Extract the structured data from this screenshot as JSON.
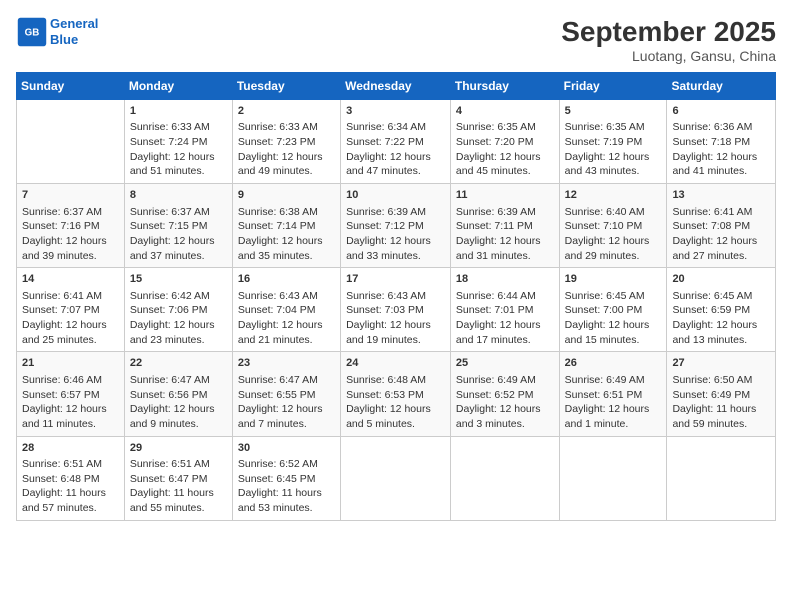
{
  "logo": {
    "line1": "General",
    "line2": "Blue"
  },
  "title": "September 2025",
  "subtitle": "Luotang, Gansu, China",
  "days_header": [
    "Sunday",
    "Monday",
    "Tuesday",
    "Wednesday",
    "Thursday",
    "Friday",
    "Saturday"
  ],
  "weeks": [
    [
      {
        "day": "",
        "sunrise": "",
        "sunset": "",
        "daylight": ""
      },
      {
        "day": "1",
        "sunrise": "Sunrise: 6:33 AM",
        "sunset": "Sunset: 7:24 PM",
        "daylight": "Daylight: 12 hours and 51 minutes."
      },
      {
        "day": "2",
        "sunrise": "Sunrise: 6:33 AM",
        "sunset": "Sunset: 7:23 PM",
        "daylight": "Daylight: 12 hours and 49 minutes."
      },
      {
        "day": "3",
        "sunrise": "Sunrise: 6:34 AM",
        "sunset": "Sunset: 7:22 PM",
        "daylight": "Daylight: 12 hours and 47 minutes."
      },
      {
        "day": "4",
        "sunrise": "Sunrise: 6:35 AM",
        "sunset": "Sunset: 7:20 PM",
        "daylight": "Daylight: 12 hours and 45 minutes."
      },
      {
        "day": "5",
        "sunrise": "Sunrise: 6:35 AM",
        "sunset": "Sunset: 7:19 PM",
        "daylight": "Daylight: 12 hours and 43 minutes."
      },
      {
        "day": "6",
        "sunrise": "Sunrise: 6:36 AM",
        "sunset": "Sunset: 7:18 PM",
        "daylight": "Daylight: 12 hours and 41 minutes."
      }
    ],
    [
      {
        "day": "7",
        "sunrise": "Sunrise: 6:37 AM",
        "sunset": "Sunset: 7:16 PM",
        "daylight": "Daylight: 12 hours and 39 minutes."
      },
      {
        "day": "8",
        "sunrise": "Sunrise: 6:37 AM",
        "sunset": "Sunset: 7:15 PM",
        "daylight": "Daylight: 12 hours and 37 minutes."
      },
      {
        "day": "9",
        "sunrise": "Sunrise: 6:38 AM",
        "sunset": "Sunset: 7:14 PM",
        "daylight": "Daylight: 12 hours and 35 minutes."
      },
      {
        "day": "10",
        "sunrise": "Sunrise: 6:39 AM",
        "sunset": "Sunset: 7:12 PM",
        "daylight": "Daylight: 12 hours and 33 minutes."
      },
      {
        "day": "11",
        "sunrise": "Sunrise: 6:39 AM",
        "sunset": "Sunset: 7:11 PM",
        "daylight": "Daylight: 12 hours and 31 minutes."
      },
      {
        "day": "12",
        "sunrise": "Sunrise: 6:40 AM",
        "sunset": "Sunset: 7:10 PM",
        "daylight": "Daylight: 12 hours and 29 minutes."
      },
      {
        "day": "13",
        "sunrise": "Sunrise: 6:41 AM",
        "sunset": "Sunset: 7:08 PM",
        "daylight": "Daylight: 12 hours and 27 minutes."
      }
    ],
    [
      {
        "day": "14",
        "sunrise": "Sunrise: 6:41 AM",
        "sunset": "Sunset: 7:07 PM",
        "daylight": "Daylight: 12 hours and 25 minutes."
      },
      {
        "day": "15",
        "sunrise": "Sunrise: 6:42 AM",
        "sunset": "Sunset: 7:06 PM",
        "daylight": "Daylight: 12 hours and 23 minutes."
      },
      {
        "day": "16",
        "sunrise": "Sunrise: 6:43 AM",
        "sunset": "Sunset: 7:04 PM",
        "daylight": "Daylight: 12 hours and 21 minutes."
      },
      {
        "day": "17",
        "sunrise": "Sunrise: 6:43 AM",
        "sunset": "Sunset: 7:03 PM",
        "daylight": "Daylight: 12 hours and 19 minutes."
      },
      {
        "day": "18",
        "sunrise": "Sunrise: 6:44 AM",
        "sunset": "Sunset: 7:01 PM",
        "daylight": "Daylight: 12 hours and 17 minutes."
      },
      {
        "day": "19",
        "sunrise": "Sunrise: 6:45 AM",
        "sunset": "Sunset: 7:00 PM",
        "daylight": "Daylight: 12 hours and 15 minutes."
      },
      {
        "day": "20",
        "sunrise": "Sunrise: 6:45 AM",
        "sunset": "Sunset: 6:59 PM",
        "daylight": "Daylight: 12 hours and 13 minutes."
      }
    ],
    [
      {
        "day": "21",
        "sunrise": "Sunrise: 6:46 AM",
        "sunset": "Sunset: 6:57 PM",
        "daylight": "Daylight: 12 hours and 11 minutes."
      },
      {
        "day": "22",
        "sunrise": "Sunrise: 6:47 AM",
        "sunset": "Sunset: 6:56 PM",
        "daylight": "Daylight: 12 hours and 9 minutes."
      },
      {
        "day": "23",
        "sunrise": "Sunrise: 6:47 AM",
        "sunset": "Sunset: 6:55 PM",
        "daylight": "Daylight: 12 hours and 7 minutes."
      },
      {
        "day": "24",
        "sunrise": "Sunrise: 6:48 AM",
        "sunset": "Sunset: 6:53 PM",
        "daylight": "Daylight: 12 hours and 5 minutes."
      },
      {
        "day": "25",
        "sunrise": "Sunrise: 6:49 AM",
        "sunset": "Sunset: 6:52 PM",
        "daylight": "Daylight: 12 hours and 3 minutes."
      },
      {
        "day": "26",
        "sunrise": "Sunrise: 6:49 AM",
        "sunset": "Sunset: 6:51 PM",
        "daylight": "Daylight: 12 hours and 1 minute."
      },
      {
        "day": "27",
        "sunrise": "Sunrise: 6:50 AM",
        "sunset": "Sunset: 6:49 PM",
        "daylight": "Daylight: 11 hours and 59 minutes."
      }
    ],
    [
      {
        "day": "28",
        "sunrise": "Sunrise: 6:51 AM",
        "sunset": "Sunset: 6:48 PM",
        "daylight": "Daylight: 11 hours and 57 minutes."
      },
      {
        "day": "29",
        "sunrise": "Sunrise: 6:51 AM",
        "sunset": "Sunset: 6:47 PM",
        "daylight": "Daylight: 11 hours and 55 minutes."
      },
      {
        "day": "30",
        "sunrise": "Sunrise: 6:52 AM",
        "sunset": "Sunset: 6:45 PM",
        "daylight": "Daylight: 11 hours and 53 minutes."
      },
      {
        "day": "",
        "sunrise": "",
        "sunset": "",
        "daylight": ""
      },
      {
        "day": "",
        "sunrise": "",
        "sunset": "",
        "daylight": ""
      },
      {
        "day": "",
        "sunrise": "",
        "sunset": "",
        "daylight": ""
      },
      {
        "day": "",
        "sunrise": "",
        "sunset": "",
        "daylight": ""
      }
    ]
  ]
}
